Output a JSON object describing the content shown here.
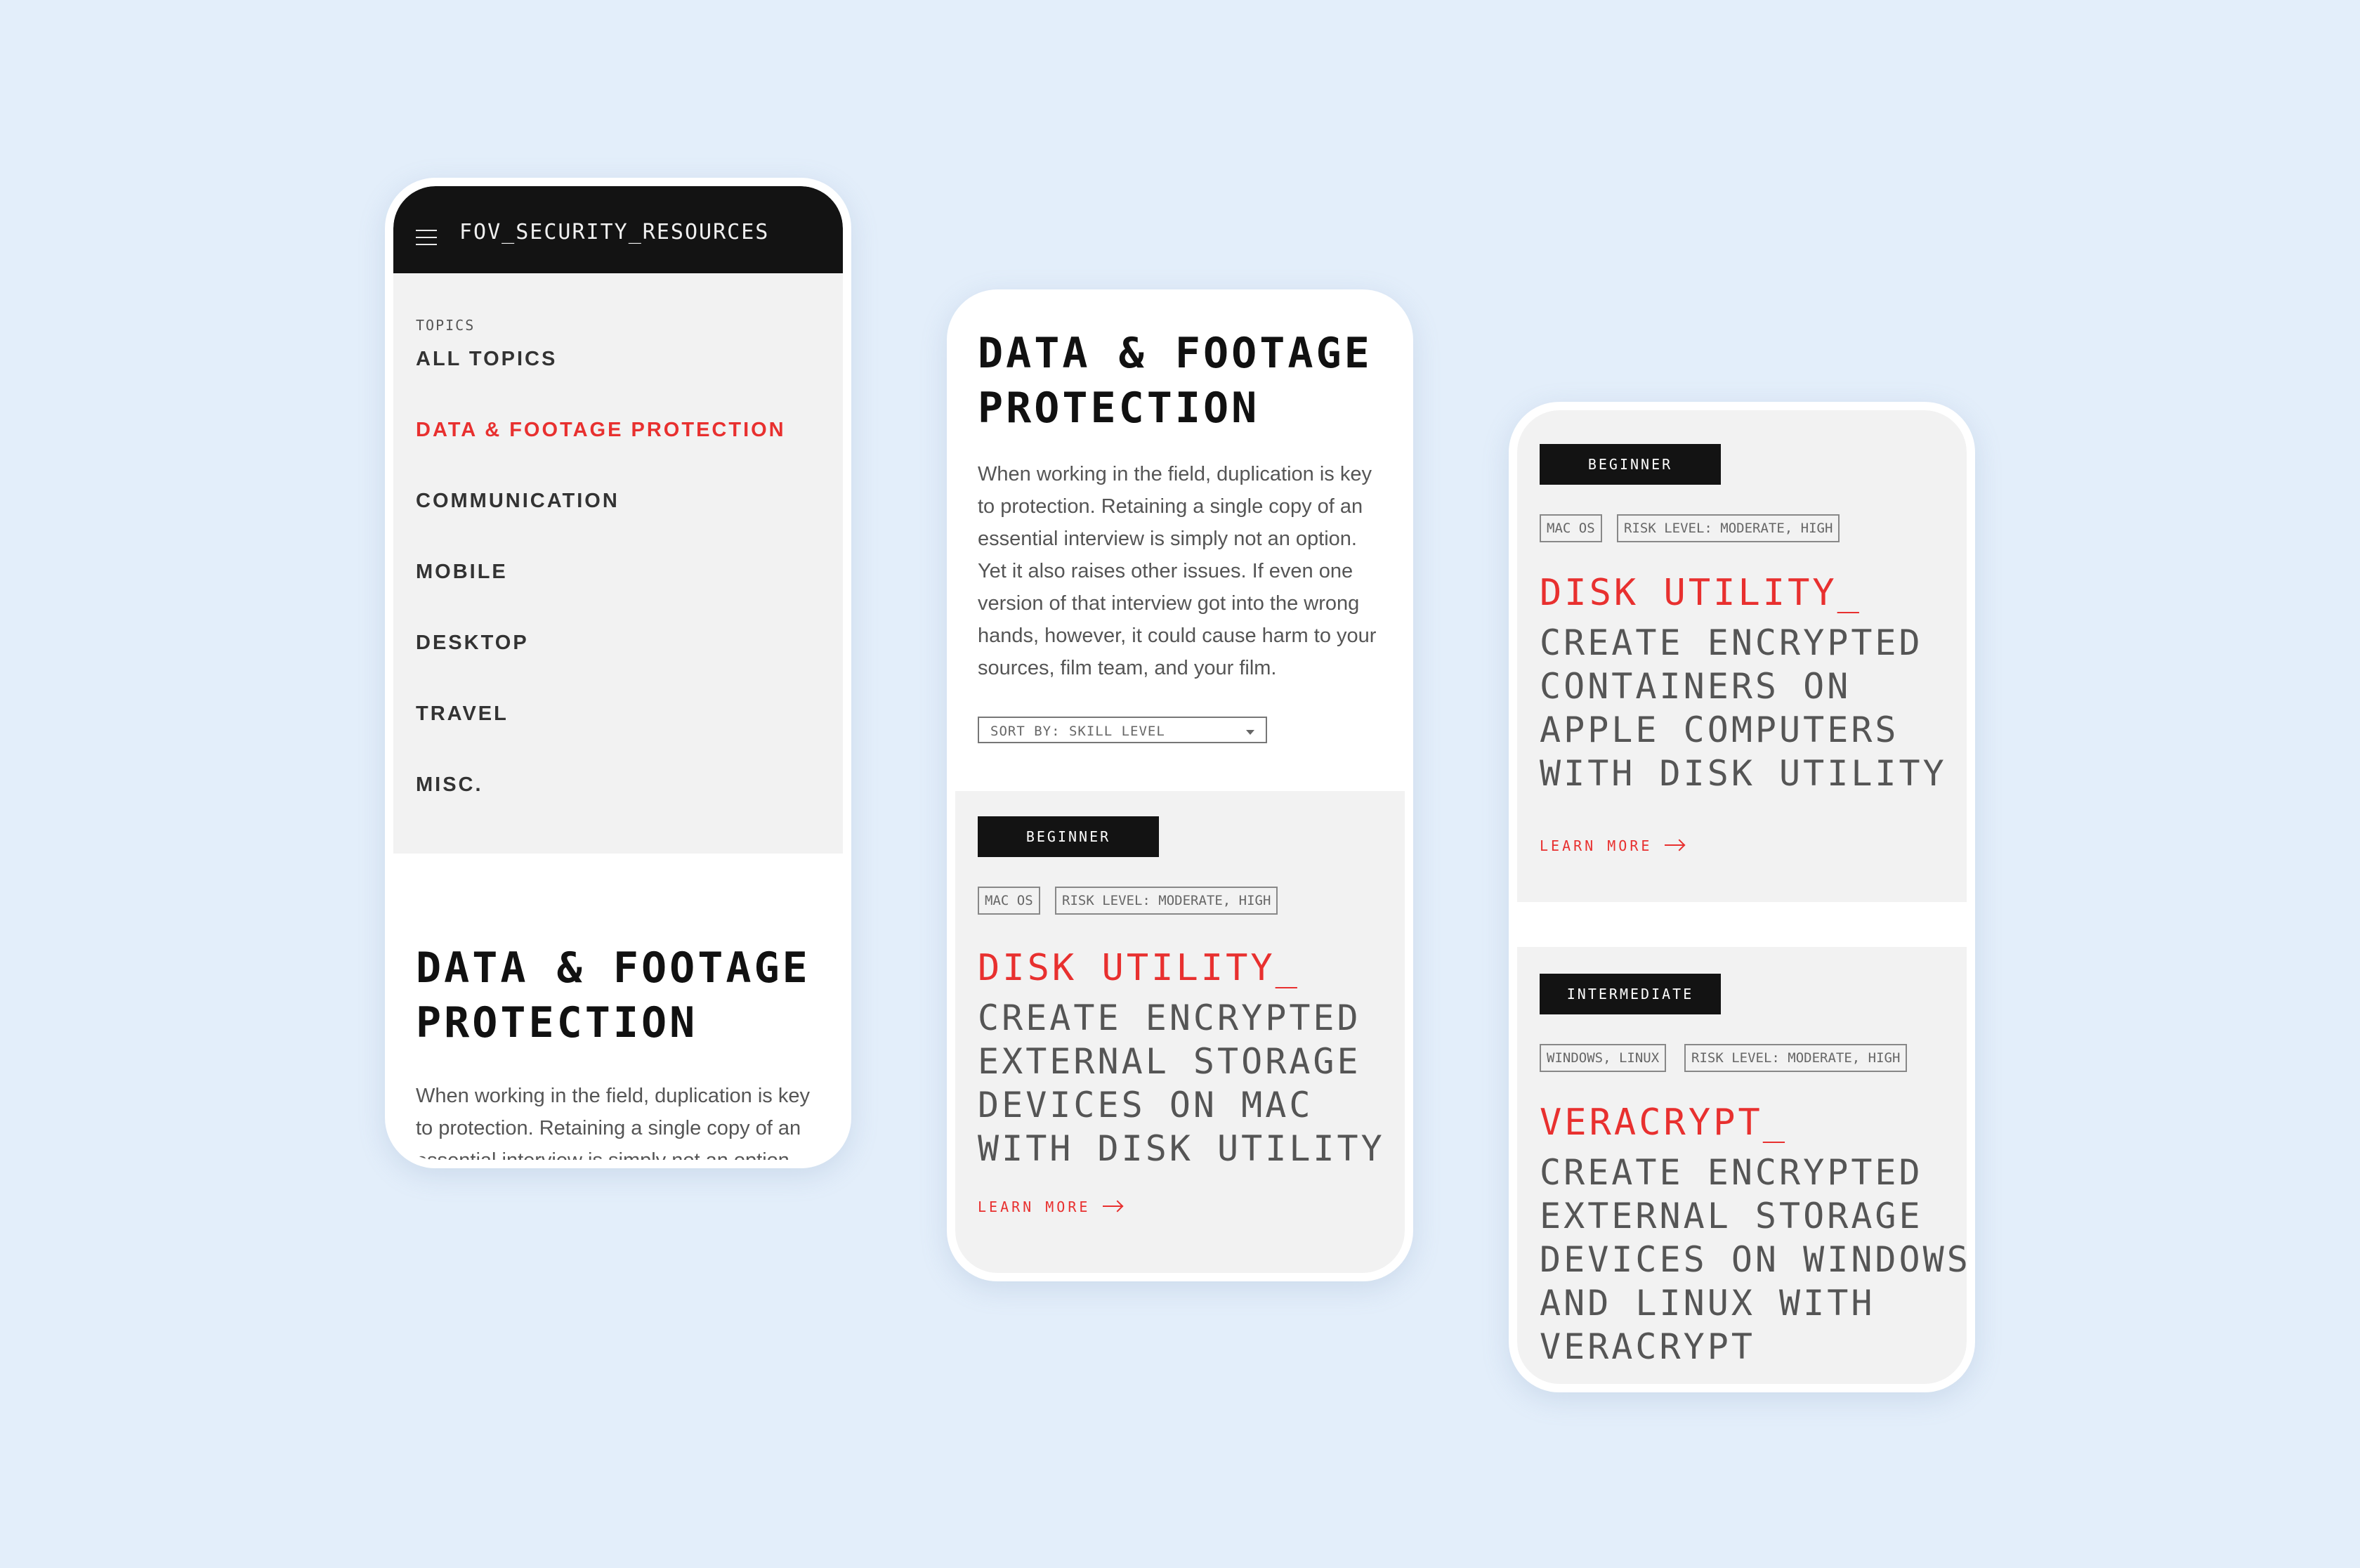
{
  "phone1": {
    "brand": "FOV_SECURITY_RESOURCES",
    "topics_label": "TOPICS",
    "menu": [
      "ALL TOPICS",
      "DATA & FOOTAGE PROTECTION",
      "COMMUNICATION",
      "MOBILE",
      "DESKTOP",
      "TRAVEL",
      "MISC."
    ],
    "heading_line1": "DATA & FOOTAGE",
    "heading_line2": "PROTECTION",
    "body_line1": "When working in the field, duplication is key",
    "body_line2": "to protection. Retaining a single copy of an",
    "body_line3": "essential interview is simply not an option."
  },
  "phone2": {
    "heading_line1": "DATA & FOOTAGE",
    "heading_line2": "PROTECTION",
    "body_lines": [
      "When working in the field, duplication is key",
      "to protection. Retaining a single copy of an",
      "essential interview is simply not an option.",
      "Yet it also raises other issues. If even one",
      "version of that interview got into the wrong",
      "hands, however, it could cause harm to your",
      "sources, film team, and your film."
    ],
    "sort_label": "SORT BY: SKILL LEVEL",
    "card": {
      "level": "BEGINNER",
      "tags": [
        "MAC OS",
        "RISK LEVEL: MODERATE, HIGH"
      ],
      "tool": "DISK UTILITY_",
      "desc_lines": [
        "CREATE ENCRYPTED",
        "EXTERNAL STORAGE",
        "DEVICES ON MAC",
        "WITH DISK UTILITY"
      ],
      "learn_more": "LEARN MORE"
    }
  },
  "phone3": {
    "card1": {
      "level": "BEGINNER",
      "tags": [
        "MAC OS",
        "RISK LEVEL: MODERATE, HIGH"
      ],
      "tool": "DISK UTILITY_",
      "desc_lines": [
        "CREATE ENCRYPTED",
        "CONTAINERS ON",
        "APPLE COMPUTERS",
        "WITH DISK UTILITY"
      ],
      "learn_more": "LEARN MORE"
    },
    "card2": {
      "level": "INTERMEDIATE",
      "tags": [
        "WINDOWS, LINUX",
        "RISK LEVEL: MODERATE, HIGH"
      ],
      "tool": "VERACRYPT_",
      "desc_lines": [
        "CREATE ENCRYPTED",
        "EXTERNAL STORAGE",
        "DEVICES ON WINDOWS",
        "AND LINUX WITH",
        "VERACRYPT"
      ]
    }
  },
  "colors": {
    "accent": "#e8302f",
    "dark": "#131313",
    "card": "#f2f2f2",
    "background": "#e3eefa"
  },
  "icons": {
    "menu": "hamburger-icon",
    "arrow": "arrow-right-icon",
    "sort": "chevron-down-icon"
  }
}
